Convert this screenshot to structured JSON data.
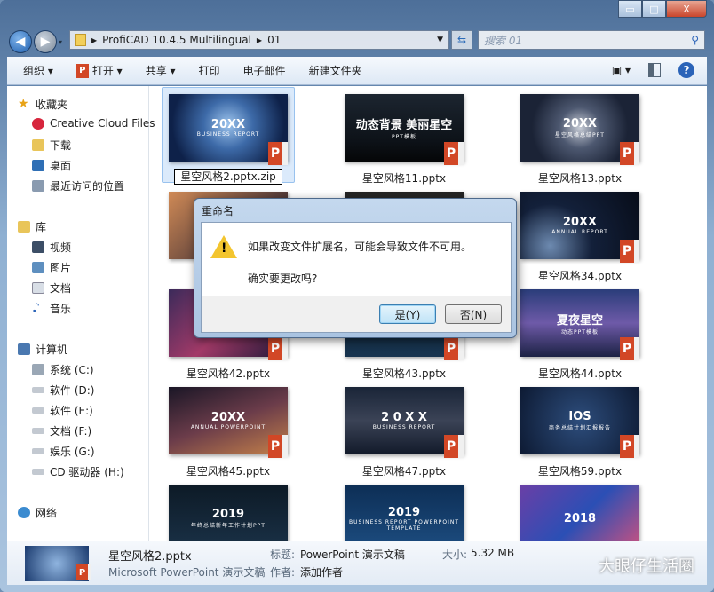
{
  "window": {
    "minimize": "▭",
    "maximize": "□",
    "close": "X"
  },
  "address": {
    "path": [
      "ProfiCAD 10.4.5 Multilingual",
      "01"
    ],
    "search_placeholder": "搜索 01"
  },
  "toolbar": {
    "organize": "组织 ▾",
    "open": "打开 ▾",
    "share": "共享 ▾",
    "print": "打印",
    "email": "电子邮件",
    "new_folder": "新建文件夹",
    "help": "?"
  },
  "sidebar": {
    "favorites": {
      "label": "收藏夹",
      "items": [
        "Creative Cloud Files",
        "下载",
        "桌面",
        "最近访问的位置"
      ]
    },
    "libraries": {
      "label": "库",
      "items": [
        "视频",
        "图片",
        "文档",
        "音乐"
      ]
    },
    "computer": {
      "label": "计算机",
      "items": [
        "系统 (C:)",
        "软件 (D:)",
        "软件 (E:)",
        "文档 (F:)",
        "娱乐 (G:)",
        "CD 驱动器 (H:)"
      ]
    },
    "network": {
      "label": "网络"
    }
  },
  "files": [
    {
      "name": "星空风格2.pptx.zip",
      "thumb_title": "20XX",
      "thumb_sub": "BUSINESS REPORT",
      "renaming": true
    },
    {
      "name": "星空风格11.pptx",
      "thumb_title": "动态背景 美丽星空",
      "thumb_sub": "PPT模板"
    },
    {
      "name": "星空风格13.pptx",
      "thumb_title": "20XX",
      "thumb_sub": "星空风格总结PPT"
    },
    {
      "name": "",
      "thumb_title": "",
      "thumb_sub": ""
    },
    {
      "name": "",
      "thumb_title": "",
      "thumb_sub": ""
    },
    {
      "name": "星空风格34.pptx",
      "thumb_title": "20XX",
      "thumb_sub": "ANNUAL REPORT"
    },
    {
      "name": "星空风格42.pptx",
      "thumb_title": "",
      "thumb_sub": ""
    },
    {
      "name": "星空风格43.pptx",
      "thumb_title": "",
      "thumb_sub": ""
    },
    {
      "name": "星空风格44.pptx",
      "thumb_title": "夏夜星空",
      "thumb_sub": "动态PPT模板"
    },
    {
      "name": "星空风格45.pptx",
      "thumb_title": "20XX",
      "thumb_sub": "ANNUAL POWERPOINT"
    },
    {
      "name": "星空风格47.pptx",
      "thumb_title": "2 0 X X",
      "thumb_sub": "BUSINESS REPORT"
    },
    {
      "name": "星空风格59.pptx",
      "thumb_title": "IOS",
      "thumb_sub": "商务总结计划汇报报告"
    },
    {
      "name": "",
      "thumb_title": "2019",
      "thumb_sub": "年终总结新年工作计划PPT"
    },
    {
      "name": "",
      "thumb_title": "2019",
      "thumb_sub": "BUSINESS REPORT POWERPOINT TEMPLATE"
    },
    {
      "name": "",
      "thumb_title": "2018",
      "thumb_sub": ""
    }
  ],
  "status": {
    "filename": "星空风格2.pptx",
    "type": "Microsoft PowerPoint 演示文稿",
    "title_label": "标题:",
    "title_value": "PowerPoint 演示文稿",
    "author_label": "作者:",
    "author_value": "添加作者",
    "size_label": "大小:",
    "size_value": "5.32 MB",
    "watermark": "大眼仔生活圈"
  },
  "dialog": {
    "title": "重命名",
    "message": "如果改变文件扩展名，可能会导致文件不可用。",
    "question": "确实要更改吗?",
    "yes": "是(Y)",
    "no": "否(N)"
  },
  "colors": {
    "accent": "#2a63b8",
    "powerpoint": "#d24726",
    "selection": "#dbeafb"
  }
}
